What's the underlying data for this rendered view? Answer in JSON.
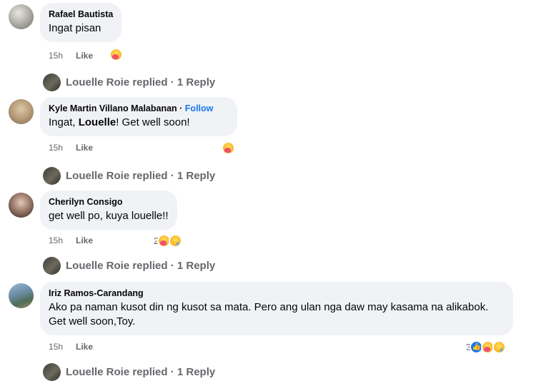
{
  "comments": [
    {
      "author": "Rafael Bautista",
      "follow": "",
      "text_parts": [
        "Ingat pisan"
      ],
      "time": "15h",
      "like": "Like",
      "reaction_count": "",
      "reactions": [
        "care"
      ],
      "reply_text": "Louelle Roie replied · 1 Reply"
    },
    {
      "author": "Kyle Martin Villano Malabanan",
      "follow": "Follow",
      "text_parts": [
        "Ingat, ",
        "Louelle",
        "! Get well soon!"
      ],
      "time": "15h",
      "like": "Like",
      "reaction_count": "",
      "reactions": [
        "care"
      ],
      "reply_text": "Louelle Roie replied · 1 Reply"
    },
    {
      "author": "Cherilyn Consigo",
      "follow": "",
      "text_parts": [
        "get well po, kuya louelle!!"
      ],
      "time": "15h",
      "like": "Like",
      "reaction_count": "2",
      "reactions": [
        "care",
        "sad"
      ],
      "reply_text": "Louelle Roie replied · 1 Reply"
    },
    {
      "author": "Iriz Ramos-Carandang",
      "follow": "",
      "text_parts": [
        "Ako pa naman kusot din ng kusot sa mata. Pero ang ulan nga daw may kasama na alikabok. Get well soon,Toy."
      ],
      "time": "15h",
      "like": "Like",
      "reaction_count": "3",
      "reactions": [
        "like",
        "care",
        "sad"
      ],
      "reply_text": "Louelle Roie replied · 1 Reply"
    }
  ],
  "colors": {
    "bubble_bg": "#f0f2f5",
    "meta_text": "#65676b",
    "follow_link": "#1877f2",
    "like_reaction": "#1877f2"
  }
}
